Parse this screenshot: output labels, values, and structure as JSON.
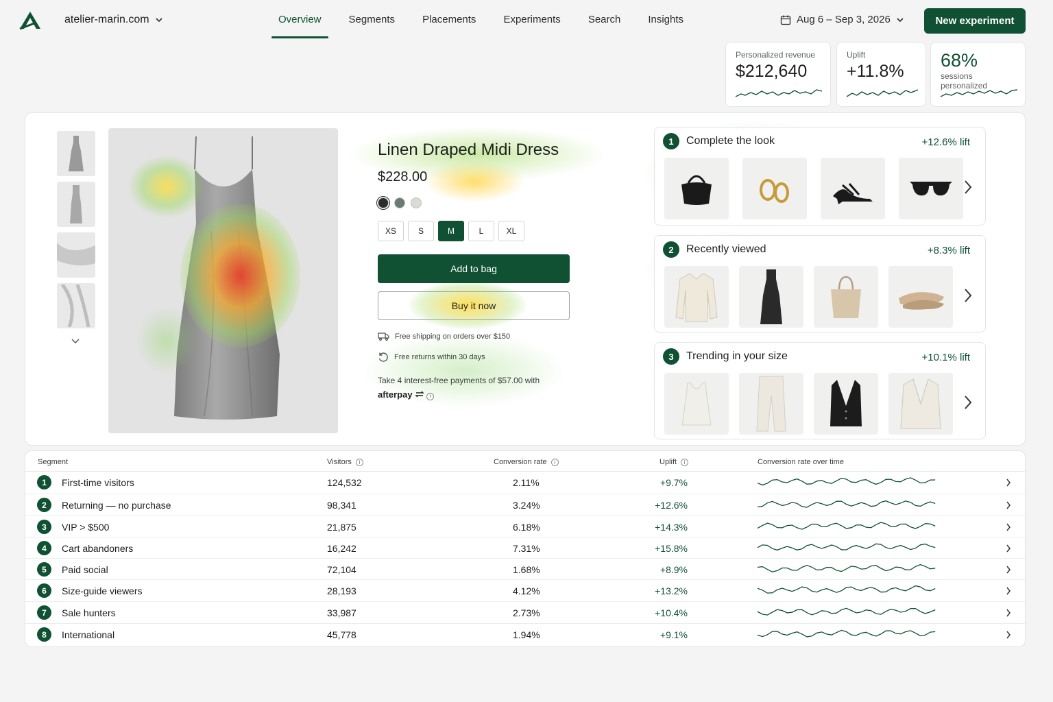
{
  "header": {
    "site": "atelier-marin.com",
    "nav": [
      "Overview",
      "Segments",
      "Placements",
      "Experiments",
      "Search",
      "Insights"
    ],
    "active_nav": "Overview",
    "date_range": "Aug 6 – Sep 3, 2026",
    "new_experiment": "New experiment"
  },
  "kpis": {
    "revenue": {
      "label": "Personalized revenue",
      "value": "$212,640"
    },
    "uplift": {
      "label": "Uplift",
      "value": "+11.8%"
    },
    "sessions": {
      "value": "68%",
      "label": "sessions personalized"
    }
  },
  "product": {
    "title": "Linen Draped Midi Dress",
    "price": "$228.00",
    "swatches": [
      "#2b2d2c",
      "#6b7a72",
      "#d9dbd4"
    ],
    "sizes": [
      "XS",
      "S",
      "M",
      "L",
      "XL"
    ],
    "selected_size": "M",
    "add_to_bag": "Add to bag",
    "buy_now": "Buy it now",
    "shipping": "Free shipping on orders over $150",
    "returns": "Free returns within 30 days",
    "afterpay_text": "Take 4 interest-free payments of $57.00 with",
    "afterpay_brand": "afterpay"
  },
  "recs": [
    {
      "num": "1",
      "title": "Complete the look",
      "lift": "+12.6% lift",
      "items": [
        "handbag-icon",
        "earrings-icon",
        "heels-icon",
        "sunglasses-icon"
      ]
    },
    {
      "num": "2",
      "title": "Recently viewed",
      "lift": "+8.3% lift",
      "items": [
        "blouse-icon",
        "slip-dress-icon",
        "tote-icon",
        "flats-icon"
      ]
    },
    {
      "num": "3",
      "title": "Trending in your size",
      "lift": "+10.1% lift",
      "items": [
        "tank-top-icon",
        "trousers-icon",
        "vest-icon",
        "blazer-icon"
      ]
    }
  ],
  "table": {
    "headers": {
      "segment": "Segment",
      "visitors": "Visitors",
      "conversion": "Conversion rate",
      "uplift": "Uplift",
      "trend": "Conversion rate over time"
    },
    "rows": [
      {
        "num": "1",
        "segment": "First-time visitors",
        "visitors": "124,532",
        "conversion": "2.11%",
        "uplift": "+9.7%"
      },
      {
        "num": "2",
        "segment": "Returning — no purchase",
        "visitors": "98,341",
        "conversion": "3.24%",
        "uplift": "+12.6%"
      },
      {
        "num": "3",
        "segment": "VIP > $500",
        "visitors": "21,875",
        "conversion": "6.18%",
        "uplift": "+14.3%"
      },
      {
        "num": "4",
        "segment": "Cart abandoners",
        "visitors": "16,242",
        "conversion": "7.31%",
        "uplift": "+15.8%"
      },
      {
        "num": "5",
        "segment": "Paid social",
        "visitors": "72,104",
        "conversion": "1.68%",
        "uplift": "+8.9%"
      },
      {
        "num": "6",
        "segment": "Size-guide viewers",
        "visitors": "28,193",
        "conversion": "4.12%",
        "uplift": "+13.2%"
      },
      {
        "num": "7",
        "segment": "Sale hunters",
        "visitors": "33,987",
        "conversion": "2.73%",
        "uplift": "+10.4%"
      },
      {
        "num": "8",
        "segment": "International",
        "visitors": "45,778",
        "conversion": "1.94%",
        "uplift": "+9.1%"
      }
    ]
  },
  "colors": {
    "brand": "#0f5132",
    "accent_text": "#0f5132"
  }
}
